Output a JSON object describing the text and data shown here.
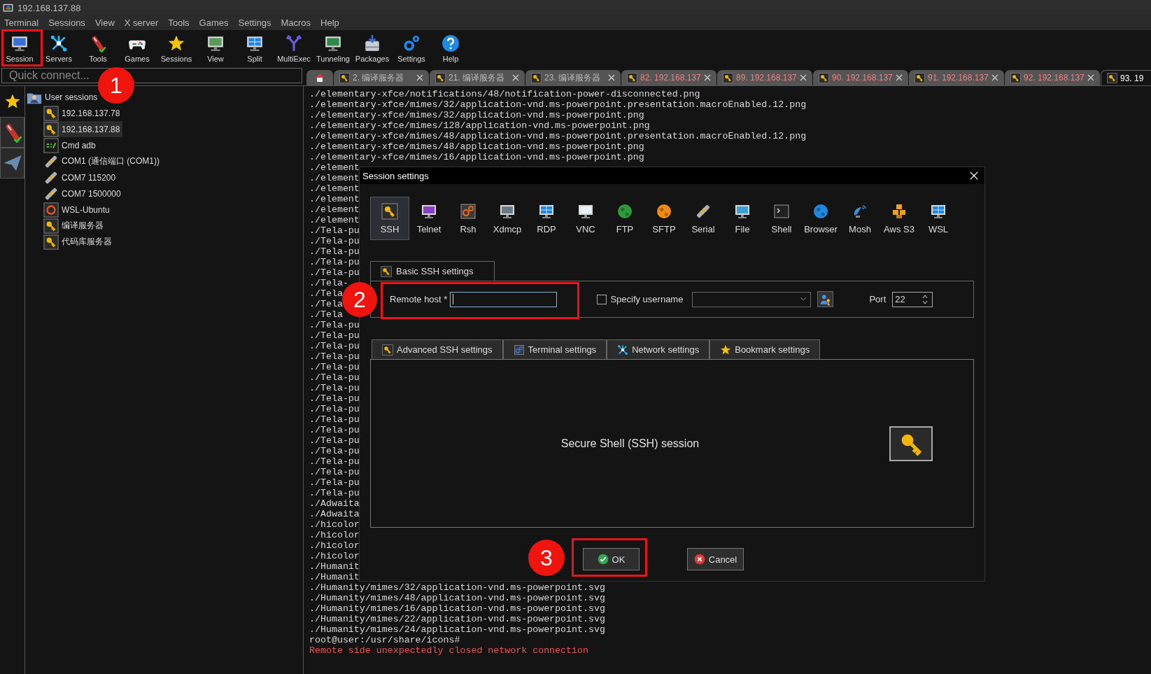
{
  "window": {
    "title": "192.168.137.88"
  },
  "menu": [
    "Terminal",
    "Sessions",
    "View",
    "X server",
    "Tools",
    "Games",
    "Settings",
    "Macros",
    "Help"
  ],
  "toolbar": [
    {
      "label": "Session",
      "kind": "session"
    },
    {
      "label": "Servers",
      "kind": "servers"
    },
    {
      "label": "Tools",
      "kind": "tools"
    },
    {
      "label": "Games",
      "kind": "games"
    },
    {
      "label": "Sessions",
      "kind": "star"
    },
    {
      "label": "View",
      "kind": "view"
    },
    {
      "label": "Split",
      "kind": "split"
    },
    {
      "label": "MultiExec",
      "kind": "multiexec"
    },
    {
      "label": "Tunneling",
      "kind": "tunneling"
    },
    {
      "label": "Packages",
      "kind": "packages"
    },
    {
      "label": "Settings",
      "kind": "settings"
    },
    {
      "label": "Help",
      "kind": "help"
    }
  ],
  "quick_connect": {
    "placeholder": "Quick connect..."
  },
  "home_tab": {
    "selected": false
  },
  "session_tabs": [
    {
      "label": "2. 编译服务器",
      "disconnected": false,
      "selected": false
    },
    {
      "label": "21. 编译服务器",
      "disconnected": false,
      "selected": false
    },
    {
      "label": "23. 编译服务器",
      "disconnected": false,
      "selected": false
    },
    {
      "label": "82. 192.168.137",
      "disconnected": true,
      "selected": false
    },
    {
      "label": "89. 192.168.137",
      "disconnected": true,
      "selected": false
    },
    {
      "label": "90. 192.168.137",
      "disconnected": true,
      "selected": false
    },
    {
      "label": "91. 192.168.137",
      "disconnected": true,
      "selected": false
    },
    {
      "label": "92. 192.168.137",
      "disconnected": true,
      "selected": false
    },
    {
      "label": "93. 19",
      "disconnected": false,
      "selected": true
    }
  ],
  "sidebar": {
    "tabs": [
      {
        "kind": "star",
        "selected": true
      },
      {
        "kind": "tools",
        "selected": false
      },
      {
        "kind": "send",
        "selected": false
      }
    ],
    "tree": [
      {
        "label": "User sessions",
        "kind": "folder",
        "selected": false,
        "children": [
          {
            "label": "192.168.137.78",
            "kind": "ssh",
            "selected": false
          },
          {
            "label": "192.168.137.88",
            "kind": "ssh",
            "selected": true
          },
          {
            "label": "Cmd adb",
            "kind": "cmd",
            "selected": false
          },
          {
            "label": "COM1  (通信端口 (COM1))",
            "kind": "serial",
            "selected": false
          },
          {
            "label": "COM7 115200",
            "kind": "serial",
            "selected": false
          },
          {
            "label": "COM7 1500000",
            "kind": "serial",
            "selected": false
          },
          {
            "label": "WSL-Ubuntu",
            "kind": "wsl",
            "selected": false
          },
          {
            "label": "编译服务器",
            "kind": "ssh",
            "selected": false
          },
          {
            "label": "代码库服务器",
            "kind": "ssh",
            "selected": false
          }
        ]
      }
    ]
  },
  "terminal": {
    "lines": [
      {
        "text": "./elementary-xfce/notifications/48/notification-power-disconnected.png",
        "kind": "output"
      },
      {
        "text": "./elementary-xfce/mimes/32/application-vnd.ms-powerpoint.presentation.macroEnabled.12.png",
        "kind": "output"
      },
      {
        "text": "./elementary-xfce/mimes/32/application-vnd.ms-powerpoint.png",
        "kind": "output"
      },
      {
        "text": "./elementary-xfce/mimes/128/application-vnd.ms-powerpoint.png",
        "kind": "output"
      },
      {
        "text": "./elementary-xfce/mimes/48/application-vnd.ms-powerpoint.presentation.macroEnabled.12.png",
        "kind": "output"
      },
      {
        "text": "./elementary-xfce/mimes/48/application-vnd.ms-powerpoint.png",
        "kind": "output"
      },
      {
        "text": "./elementary-xfce/mimes/16/application-vnd.ms-powerpoint.png",
        "kind": "output"
      },
      {
        "text": "./element",
        "kind": "output"
      },
      {
        "text": "./element",
        "kind": "output"
      },
      {
        "text": "./element",
        "kind": "output"
      },
      {
        "text": "./element",
        "kind": "output"
      },
      {
        "text": "./element",
        "kind": "output"
      },
      {
        "text": "./element",
        "kind": "output"
      },
      {
        "text": "./Tela-pu",
        "kind": "output"
      },
      {
        "text": "./Tela-pu",
        "kind": "output"
      },
      {
        "text": "./Tela-pu",
        "kind": "output"
      },
      {
        "text": "./Tela-pu",
        "kind": "output"
      },
      {
        "text": "./Tela-pu",
        "kind": "output"
      },
      {
        "text": "./Tela-",
        "kind": "output"
      },
      {
        "text": "./Tela",
        "kind": "output"
      },
      {
        "text": "./Tela",
        "kind": "output"
      },
      {
        "text": "./Tela",
        "kind": "output"
      },
      {
        "text": "./Tela-pu",
        "kind": "output"
      },
      {
        "text": "./Tela-pu",
        "kind": "output"
      },
      {
        "text": "./Tela-pu",
        "kind": "output"
      },
      {
        "text": "./Tela-pu",
        "kind": "output"
      },
      {
        "text": "./Tela-pu",
        "kind": "output"
      },
      {
        "text": "./Tela-pu",
        "kind": "output"
      },
      {
        "text": "./Tela-pu",
        "kind": "output"
      },
      {
        "text": "./Tela-pu",
        "kind": "output"
      },
      {
        "text": "./Tela-pu",
        "kind": "output"
      },
      {
        "text": "./Tela-pu",
        "kind": "output"
      },
      {
        "text": "./Tela-pu",
        "kind": "output"
      },
      {
        "text": "./Tela-pu",
        "kind": "output"
      },
      {
        "text": "./Tela-pu",
        "kind": "output"
      },
      {
        "text": "./Tela-pu",
        "kind": "output"
      },
      {
        "text": "./Tela-pu",
        "kind": "output"
      },
      {
        "text": "./Tela-pu",
        "kind": "output"
      },
      {
        "text": "./Tela-pu",
        "kind": "output"
      },
      {
        "text": "./Adwaita",
        "kind": "output"
      },
      {
        "text": "./Adwaita",
        "kind": "output"
      },
      {
        "text": "./hicolor",
        "kind": "output"
      },
      {
        "text": "./hicolor",
        "kind": "output"
      },
      {
        "text": "./hicolor",
        "kind": "output"
      },
      {
        "text": "./hicolor",
        "kind": "output"
      },
      {
        "text": "./Humanit",
        "kind": "output"
      },
      {
        "text": "./Humanit",
        "kind": "output"
      },
      {
        "text": "./Humanity/mimes/32/application-vnd.ms-powerpoint.svg",
        "kind": "output"
      },
      {
        "text": "./Humanity/mimes/48/application-vnd.ms-powerpoint.svg",
        "kind": "output"
      },
      {
        "text": "./Humanity/mimes/16/application-vnd.ms-powerpoint.svg",
        "kind": "output"
      },
      {
        "text": "./Humanity/mimes/22/application-vnd.ms-powerpoint.svg",
        "kind": "output"
      },
      {
        "text": "./Humanity/mimes/24/application-vnd.ms-powerpoint.svg",
        "kind": "output"
      },
      {
        "text": "root@user:/usr/share/icons#",
        "kind": "output"
      },
      {
        "text": "Remote side unexpectedly closed network connection",
        "kind": "error"
      }
    ]
  },
  "dialog": {
    "title": "Session settings",
    "session_types": [
      {
        "label": "SSH",
        "kind": "ssh",
        "selected": true
      },
      {
        "label": "Telnet",
        "kind": "telnet",
        "selected": false
      },
      {
        "label": "Rsh",
        "kind": "rsh",
        "selected": false
      },
      {
        "label": "Xdmcp",
        "kind": "xdmcp",
        "selected": false
      },
      {
        "label": "RDP",
        "kind": "rdp",
        "selected": false
      },
      {
        "label": "VNC",
        "kind": "vnc",
        "selected": false
      },
      {
        "label": "FTP",
        "kind": "ftp",
        "selected": false
      },
      {
        "label": "SFTP",
        "kind": "sftp",
        "selected": false
      },
      {
        "label": "Serial",
        "kind": "serial",
        "selected": false
      },
      {
        "label": "File",
        "kind": "file",
        "selected": false
      },
      {
        "label": "Shell",
        "kind": "shell",
        "selected": false
      },
      {
        "label": "Browser",
        "kind": "browser",
        "selected": false
      },
      {
        "label": "Mosh",
        "kind": "mosh",
        "selected": false
      },
      {
        "label": "Aws S3",
        "kind": "aws",
        "selected": false
      },
      {
        "label": "WSL",
        "kind": "wsl",
        "selected": false
      }
    ],
    "basic_tab": {
      "label": "Basic SSH settings"
    },
    "remote_host": {
      "label": "Remote host *"
    },
    "specify_username": {
      "label": "Specify username",
      "checked": false
    },
    "port": {
      "label": "Port",
      "value": "22"
    },
    "settings_tabs": [
      {
        "label": "Advanced SSH settings",
        "kind": "ssh"
      },
      {
        "label": "Terminal settings",
        "kind": "terminal"
      },
      {
        "label": "Network settings",
        "kind": "network"
      },
      {
        "label": "Bookmark settings",
        "kind": "bookmark"
      }
    ],
    "description": "Secure Shell (SSH) session",
    "buttons": [
      {
        "label": "OK",
        "kind": "ok"
      },
      {
        "label": "Cancel",
        "kind": "cancel"
      }
    ]
  },
  "annotations": [
    {
      "label": "1"
    },
    {
      "label": "2"
    },
    {
      "label": "3"
    }
  ]
}
